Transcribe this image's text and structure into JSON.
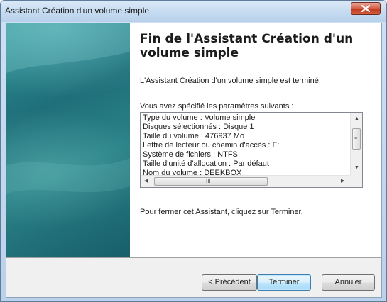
{
  "window": {
    "title": "Assistant Création d'un volume simple",
    "close_icon": "close-icon"
  },
  "page": {
    "heading": "Fin de l'Assistant Création d'un volume simple",
    "intro": "L'Assistant Création d'un volume simple est terminé.",
    "summary_label": "Vous avez spécifié les paramètres suivants :",
    "summary_lines": [
      "Type du volume : Volume simple",
      "Disques sélectionnés : Disque 1",
      "Taille du volume : 476937 Mo",
      "Lettre de lecteur ou chemin d'accès : F:",
      "Système de fichiers : NTFS",
      "Taille d'unité d'allocation : Par défaut",
      "Nom du volume : DEEKBOX"
    ],
    "close_hint": "Pour fermer cet Assistant, cliquez sur Terminer."
  },
  "scrollbar": {
    "up_arrow": "▲",
    "down_arrow": "▼",
    "left_arrow": "◀",
    "right_arrow": "▶",
    "grip": "≡",
    "hgrip": "III"
  },
  "buttons": {
    "back": "< Précédent",
    "finish": "Terminer",
    "cancel": "Annuler"
  },
  "colors": {
    "side_panel": "#1f6f7a",
    "close_button": "#c0391f",
    "default_button_border": "#3c7fb1"
  }
}
